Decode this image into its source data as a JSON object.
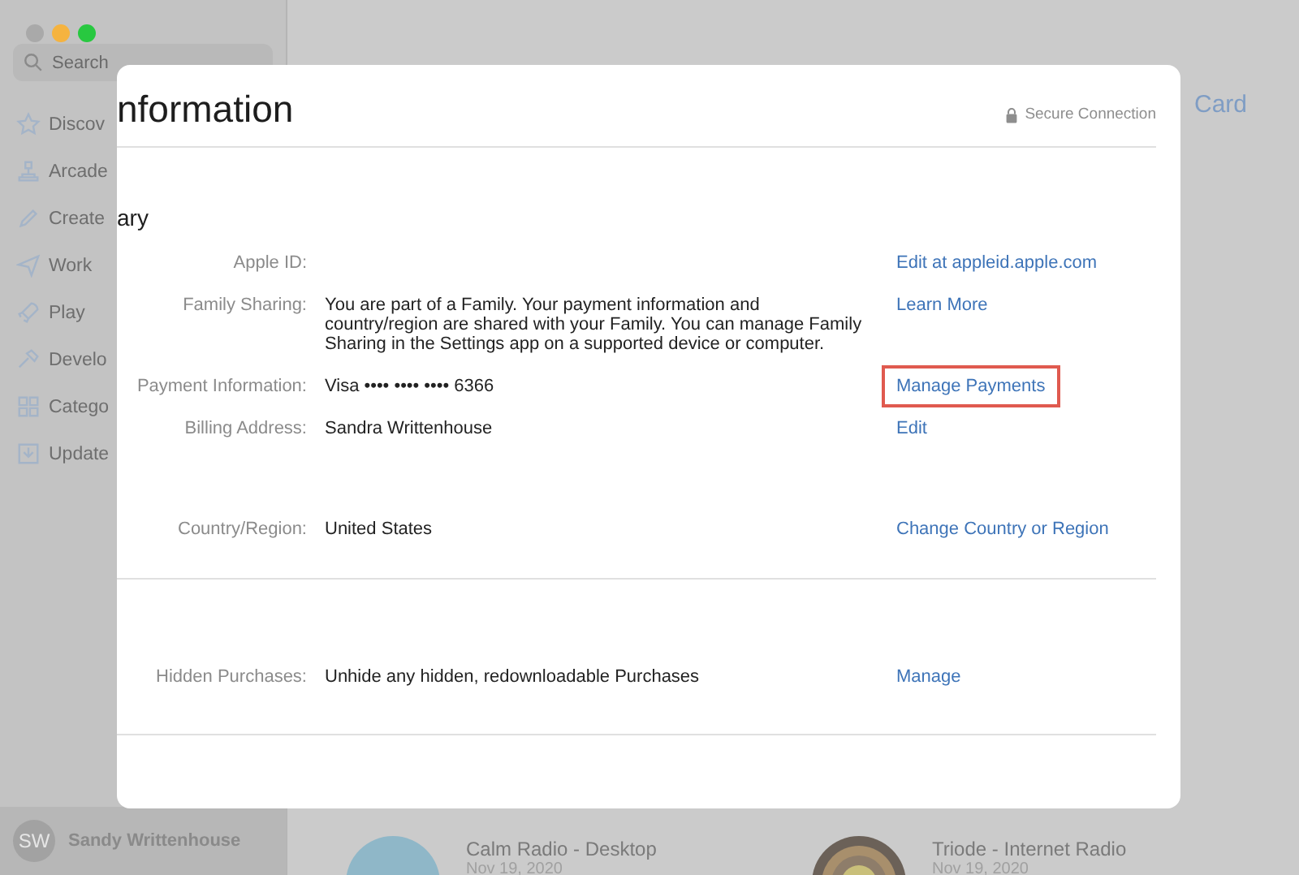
{
  "sidebar": {
    "window_controls": [
      {
        "kind": "close",
        "disabled": true
      },
      {
        "kind": "minimize",
        "disabled": false
      },
      {
        "kind": "zoom",
        "disabled": false
      }
    ],
    "search": {
      "placeholder": "Search"
    },
    "items": [
      {
        "label": "Discov"
      },
      {
        "label": "Arcade"
      },
      {
        "label": "Create"
      },
      {
        "label": "Work"
      },
      {
        "label": "Play"
      },
      {
        "label": "Develo"
      },
      {
        "label": "Catego"
      },
      {
        "label": "Update"
      }
    ],
    "user": {
      "initials": "SW",
      "name": "Sandy Writtenhouse"
    }
  },
  "main": {
    "header_link": "Card",
    "apps": [
      {
        "name": "Calm Radio - Desktop",
        "date": "Nov 19, 2020",
        "kind": "disc"
      },
      {
        "name": "Triode - Internet Radio",
        "date": "Nov 19, 2020",
        "kind": "rings"
      }
    ]
  },
  "dialog": {
    "title": "nformation",
    "secure_label": "Secure Connection",
    "section_title": "ary",
    "sections": [
      {
        "rows": [
          {
            "label": "Apple ID:",
            "value": "",
            "link": "Edit at appleid.apple.com",
            "highlighted": false
          },
          {
            "label": "Family Sharing:",
            "value": "You are part of a Family. Your payment information and country/region are shared with your Family. You can manage Family Sharing in the Settings app on a supported device or computer.",
            "link": "Learn More",
            "highlighted": false
          },
          {
            "label": "Payment Information:",
            "value": "Visa •••• •••• •••• 6366",
            "link": "Manage Payments",
            "highlighted": true
          },
          {
            "label": "Billing Address:",
            "value": "Sandra Writtenhouse",
            "link": "Edit",
            "highlighted": false
          },
          {
            "label": "Country/Region:",
            "value": "United States",
            "link": "Change Country or Region",
            "highlighted": false
          }
        ]
      },
      {
        "rows": [
          {
            "label": "Hidden Purchases:",
            "value": "Unhide any hidden, redownloadable Purchases",
            "link": "Manage",
            "highlighted": false
          }
        ]
      }
    ]
  }
}
